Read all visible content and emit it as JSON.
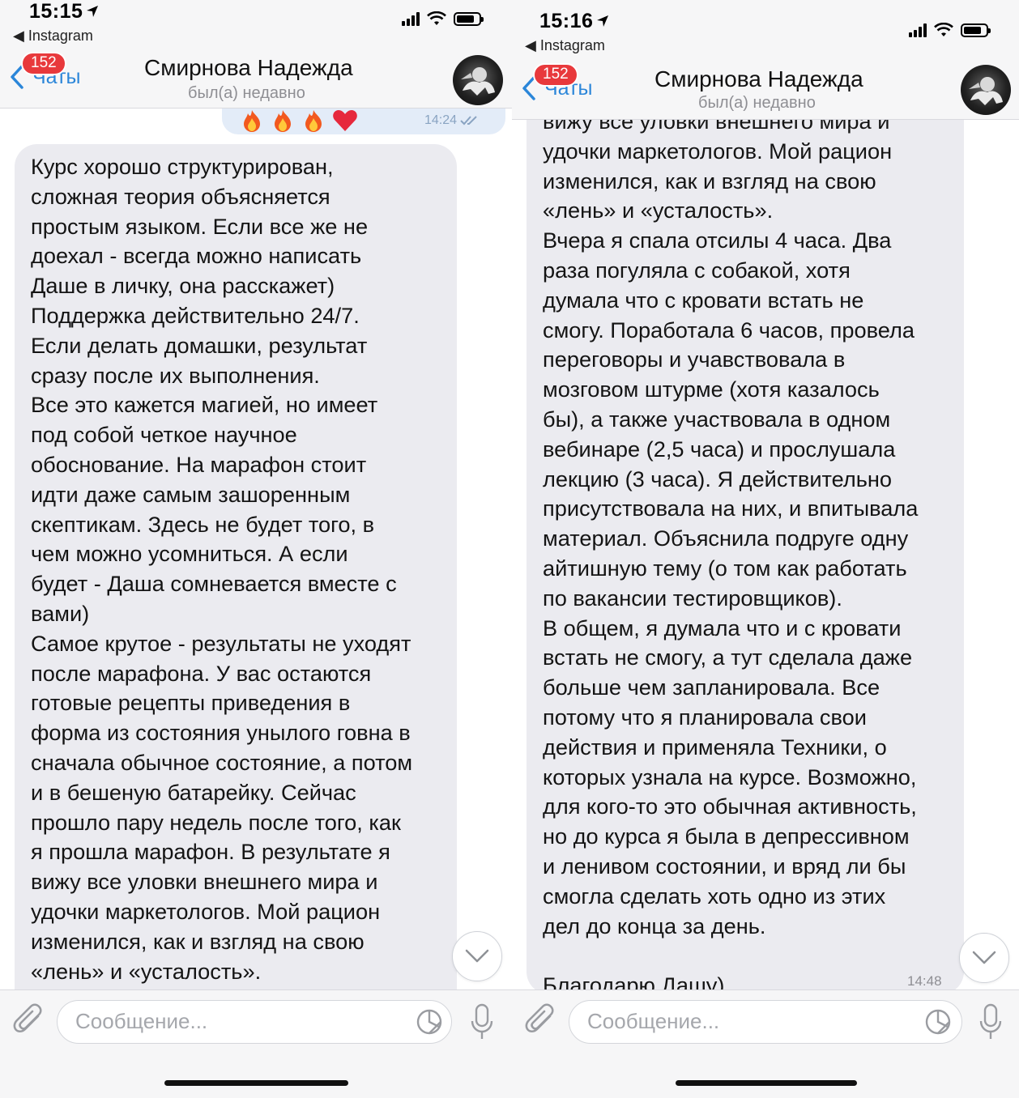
{
  "screens": [
    {
      "status": {
        "time": "15:15",
        "back_app": "◀ Instagram"
      },
      "header": {
        "back_label": "Чаты",
        "unread_badge": "152",
        "contact_name": "Смирнова Надежда",
        "last_seen": "был(а) недавно"
      },
      "outgoing": {
        "reactions": [
          "fire",
          "fire",
          "fire",
          "heart"
        ],
        "time": "14:24"
      },
      "message": {
        "text": "Курс хорошо структурирован,\nсложная теория объясняется\nпростым языком. Если все же не\nдоехал - всегда можно написать\nДаше в личку, она расскажет)\nПоддержка действительно 24/7.\nЕсли делать домашки, результат\nсразу после их выполнения.\nВсе это кажется магией, но имеет\nпод собой четкое научное\nобоснование. На марафон стоит\nидти даже самым зашоренным\nскептикам. Здесь не будет того, в\nчем можно усомниться. А если\nбудет - Даша сомневается вместе с\nвами)\nСамое крутое - результаты не уходят\nпосле марафона. У вас остаются\nготовые рецепты приведения в\nформа из состояния унылого говна в\nсначала обычное состояние, а потом\nи в бешеную батарейку. Сейчас\nпрошло пару недель после того, как\nя прошла марафон. В результате я\nвижу все уловки внешнего мира и\nудочки маркетологов. Мой рацион\nизменился, как и взгляд на свою\n«лень» и «усталость»."
      },
      "input": {
        "placeholder": "Сообщение..."
      }
    },
    {
      "status": {
        "time": "15:16",
        "back_app": "◀ Instagram"
      },
      "header": {
        "back_label": "Чаты",
        "unread_badge": "152",
        "contact_name": "Смирнова Надежда",
        "last_seen": "был(а) недавно"
      },
      "message": {
        "text": "вижу все уловки внешнего мира и\nудочки маркетологов. Мой рацион\nизменился, как и взгляд на свою\n«лень» и «усталость».\nВчера я спала отсилы 4 часа. Два\nраза погуляла с собакой, хотя\nдумала что с кровати встать не\nсмогу. Поработала 6 часов, провела\nпереговоры и учавствовала в\nмозговом штурме (хотя казалось\nбы), а также участвовала в одном\nвебинаре (2,5 часа) и прослушала\nлекцию (3 часа). Я действительно\nприсутствовала на них, и впитывала\nматериал. Объяснила подруге одну\nайтишную тему (о том как работать\nпо вакансии тестировщиков).\nВ общем, я думала что и с кровати\nвстать не смогу, а тут сделала даже\nбольше чем запланировала. Все\nпотому что я планировала свои\nдействия и применяла Техники, о\nкоторых узнала на курсе. Возможно,\nдля кого-то это обычная активность,\nно до курса я была в депрессивном\nи ленивом состоянии, и вряд ли бы\nсмогла сделать хоть одно из этих\nдел до конца за день.\n\nБлагодарю Дашу)",
        "time": "14:48"
      },
      "input": {
        "placeholder": "Сообщение..."
      }
    }
  ]
}
